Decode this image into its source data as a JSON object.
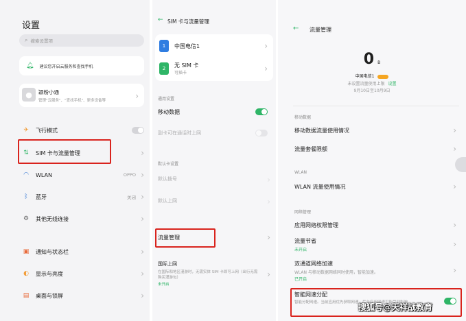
{
  "panel1": {
    "title": "设置",
    "search_placeholder": "搜索设置项",
    "cloud_tip": "建议您开启云服务和查找手机",
    "account": {
      "name": "颖粉小通",
      "desc": "管理\"云服务\"、\"查找手机\"、更多设备等"
    },
    "items": [
      {
        "label": "飞行模式",
        "value": ""
      },
      {
        "label": "SIM 卡与流量管理",
        "value": ""
      },
      {
        "label": "WLAN",
        "value": "OPPO"
      },
      {
        "label": "蓝牙",
        "value": "关闭"
      },
      {
        "label": "其他无线连接",
        "value": ""
      },
      {
        "label": "通知与状态栏",
        "value": ""
      },
      {
        "label": "显示与亮度",
        "value": ""
      },
      {
        "label": "桌面与锁屏",
        "value": ""
      }
    ]
  },
  "panel2": {
    "title": "SIM 卡与流量管理",
    "sim1": {
      "name": "中国电信1"
    },
    "sim2": {
      "name": "无 SIM 卡",
      "sub": "可插卡"
    },
    "section_general": "通用设置",
    "mobile_data": "移动数据",
    "sim2_internet": "副卡可在通话时上网",
    "sim2_internet_sub": "",
    "section_default": "默认卡设置",
    "default_call": "默认拨号",
    "default_call_sub": "",
    "default_net": "默认上网",
    "default_net_sub": "",
    "traffic_mgmt": "流量管理",
    "intl": "国际上网",
    "intl_desc": "在国际和地区漫游时，无需实体 SIM 卡即可上网（出行无需购买漫游包）",
    "intl_status": "未开启"
  },
  "panel3": {
    "title": "流量管理",
    "usage_value": "0",
    "usage_unit": "B",
    "carrier": "中国电信1",
    "carrier_badge": "",
    "limit_tip": "未设置流量使用上限",
    "limit_link": "设置",
    "date_range": "9月10日至10月9日",
    "section_mobile": "移动数据",
    "mobile_usage": "移动数据流量使用情况",
    "package_limit": "流量套餐限额",
    "section_wlan": "WLAN",
    "wlan_usage": "WLAN 流量使用情况",
    "section_net": "网络管理",
    "app_perm": "应用网络权限管理",
    "saver": "流量节省",
    "saver_status": "未开启",
    "dual": "双通道网络加速",
    "dual_desc": "WLAN 与移动数据网络同时使用，智能加速。",
    "dual_status": "已开启",
    "smart": "智能网速分配",
    "smart_desc": "智能分配网速。当前应用优先获取网速，后台应用网速可能受到影响。"
  },
  "watermark": "搜狐号@天祥战教育",
  "colors": {
    "toggle_on": "#2fb567",
    "link": "#2fb567",
    "badge": "#f5a623",
    "highlight": "#d9231d"
  }
}
